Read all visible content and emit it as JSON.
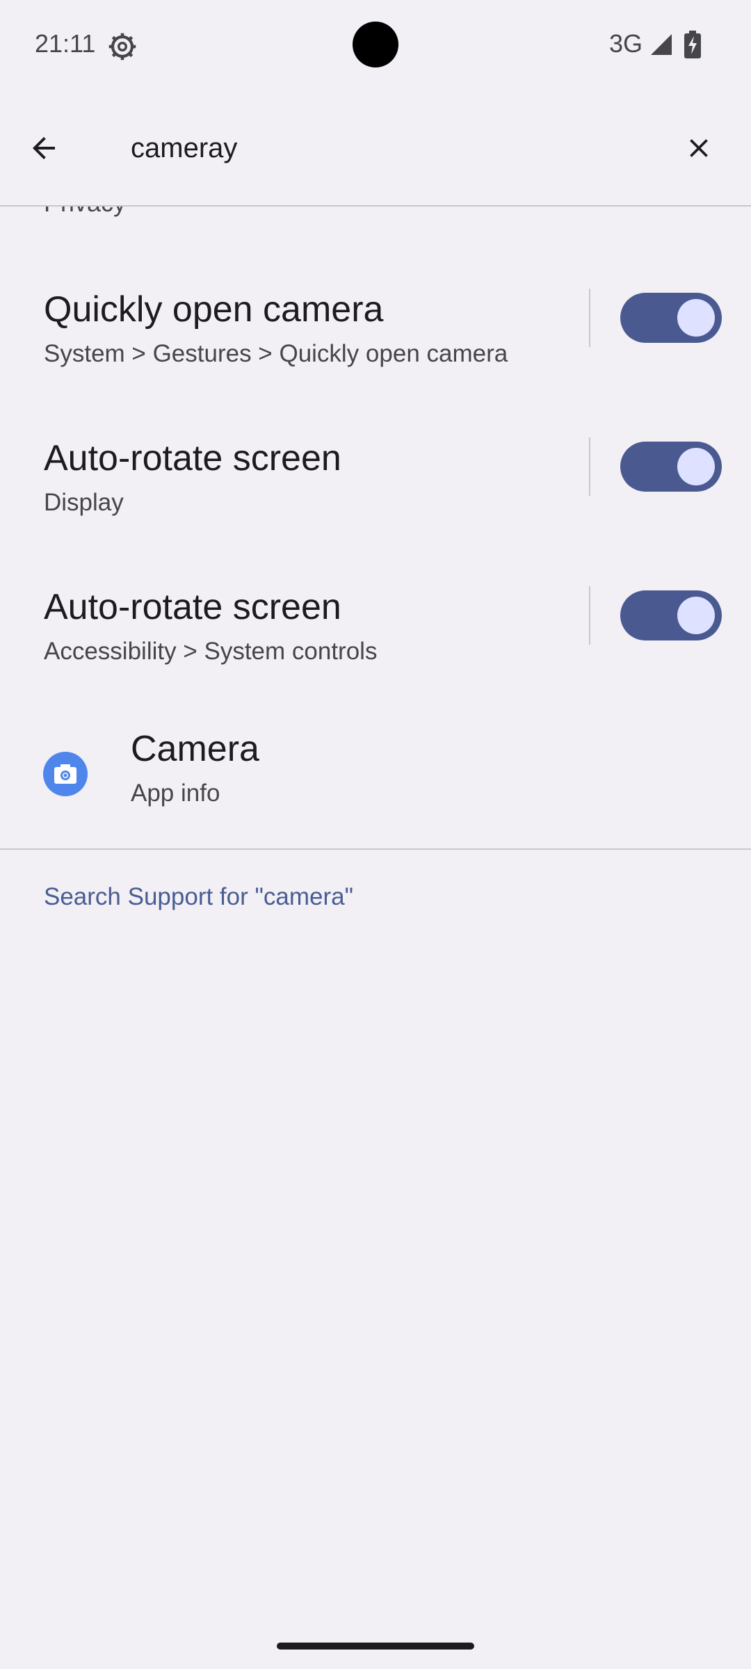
{
  "status_bar": {
    "time": "21:11",
    "settings_icon": "gear-icon",
    "network": "3G",
    "signal_icon": "signal-icon",
    "battery_icon": "battery-charging-icon"
  },
  "search": {
    "query": "cameray",
    "back_icon": "arrow-back-icon",
    "clear_icon": "close-icon"
  },
  "results": {
    "partial_subtitle": "Privacy",
    "items": [
      {
        "title": "Quickly open camera",
        "subtitle": "System > Gestures > Quickly open camera",
        "toggle": "on"
      },
      {
        "title": "Auto-rotate screen",
        "subtitle": "Display",
        "toggle": "on"
      },
      {
        "title": "Auto-rotate screen",
        "subtitle": "Accessibility > System controls",
        "toggle": "on"
      }
    ],
    "app_item": {
      "title": "Camera",
      "subtitle": "App info",
      "icon": "camera-app-icon"
    }
  },
  "support": {
    "link_text": "Search Support for \"camera\""
  },
  "colors": {
    "background": "#f2eff5",
    "toggle_track": "#4a5a90",
    "toggle_knob": "#dee1ff",
    "link": "#485d92",
    "camera_icon_bg": "#4f86ec"
  }
}
